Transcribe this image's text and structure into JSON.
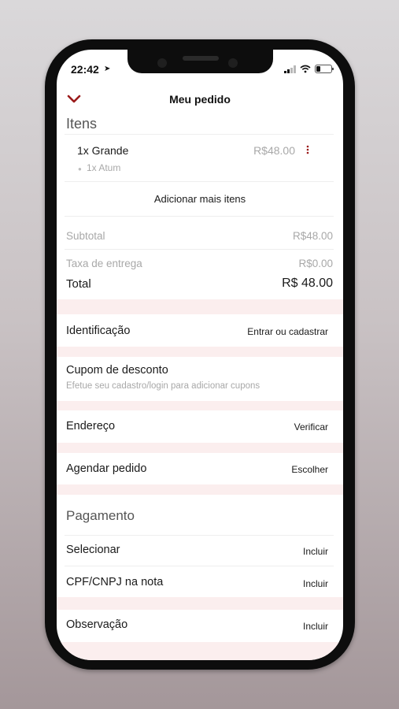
{
  "status_bar": {
    "time": "22:42"
  },
  "header": {
    "title": "Meu pedido"
  },
  "items": {
    "section_title": "Itens",
    "list": [
      {
        "name": "1x Grande",
        "price": "R$48.00",
        "detail": "1x Atum"
      }
    ],
    "add_more_label": "Adicionar mais itens"
  },
  "summary": {
    "subtotal_label": "Subtotal",
    "subtotal_value": "R$48.00",
    "delivery_label": "Taxa de entrega",
    "delivery_value": "R$0.00",
    "total_label": "Total",
    "total_value": "R$ 48.00"
  },
  "identification": {
    "label": "Identificação",
    "action": "Entrar ou cadastrar"
  },
  "coupon": {
    "label": "Cupom de desconto",
    "hint": "Efetue seu cadastro/login para adicionar cupons"
  },
  "address": {
    "label": "Endereço",
    "action": "Verificar"
  },
  "schedule": {
    "label": "Agendar pedido",
    "action": "Escolher"
  },
  "payment": {
    "section_title": "Pagamento",
    "select_label": "Selecionar",
    "select_action": "Incluir",
    "cpf_label": "CPF/CNPJ na nota",
    "cpf_action": "Incluir"
  },
  "observation": {
    "label": "Observação",
    "action": "Incluir"
  },
  "colors": {
    "accent": "#9b1b1b",
    "band": "#fbeeee"
  }
}
